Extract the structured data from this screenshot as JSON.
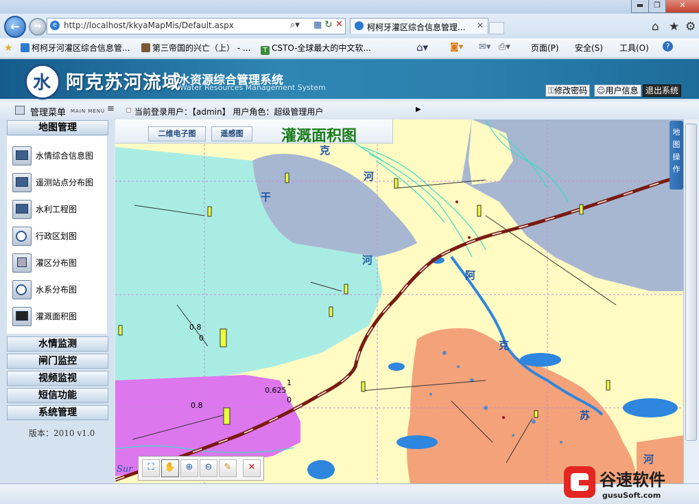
{
  "browser": {
    "url": "http://localhost/kkyaMapMis/Default.aspx",
    "tab_title": "柯柯牙灌区综合信息管理...",
    "favorites": [
      "柯柯牙河灌区综合信息管...",
      "第三帝国的兴亡（上） - ...",
      "CSTO-全球最大的中文软..."
    ],
    "commands": [
      "页面(P)",
      "安全(S)",
      "工具(O)"
    ]
  },
  "app": {
    "title": "阿克苏河流域",
    "subtitle": "水资源综合管理系统",
    "subtitle_en": "Water Resources Management System",
    "buttons": [
      "修改密码",
      "用户信息",
      "退出系统"
    ],
    "logo_text": "水"
  },
  "info": {
    "menu_title": "管理菜单",
    "menu_title_en": "MAIN MENU",
    "login_text": "当前登录用户：【admin】 用户角色：超级管理用户"
  },
  "sidebar": {
    "active_section": "地图管理",
    "items": [
      "水情综合信息图",
      "遥测站点分布图",
      "水利工程图",
      "行政区划图",
      "灌区分布图",
      "水系分布图",
      "灌溉面积图"
    ],
    "sections": [
      "水情监测",
      "闸门监控",
      "视频监视",
      "短信功能",
      "系统管理"
    ],
    "version": "版本：2010 v1.0"
  },
  "map": {
    "tabs": [
      "二维电子图",
      "遥感图"
    ],
    "title": "灌溉面积图",
    "operations_label": "地图操作",
    "labels": [
      "克",
      "河",
      "干",
      "河",
      "阿",
      "克",
      "苏",
      "河"
    ],
    "gauge_labels": [
      "0.8",
      "0.625",
      "0.8",
      "1",
      "0",
      "0"
    ],
    "corner_text": "Sur",
    "colors": {
      "river_blue": "#2e86de",
      "cyan_zone": "#a9ece4",
      "gray_zone": "#a7b7d1",
      "orange_zone": "#f4a27a",
      "magenta_zone": "#dd77ee",
      "yellow_zone": "#fffbc3",
      "road": "#7a1a10"
    }
  },
  "watermark": {
    "brand": "谷速软件",
    "site": "gusuSoft.com"
  }
}
